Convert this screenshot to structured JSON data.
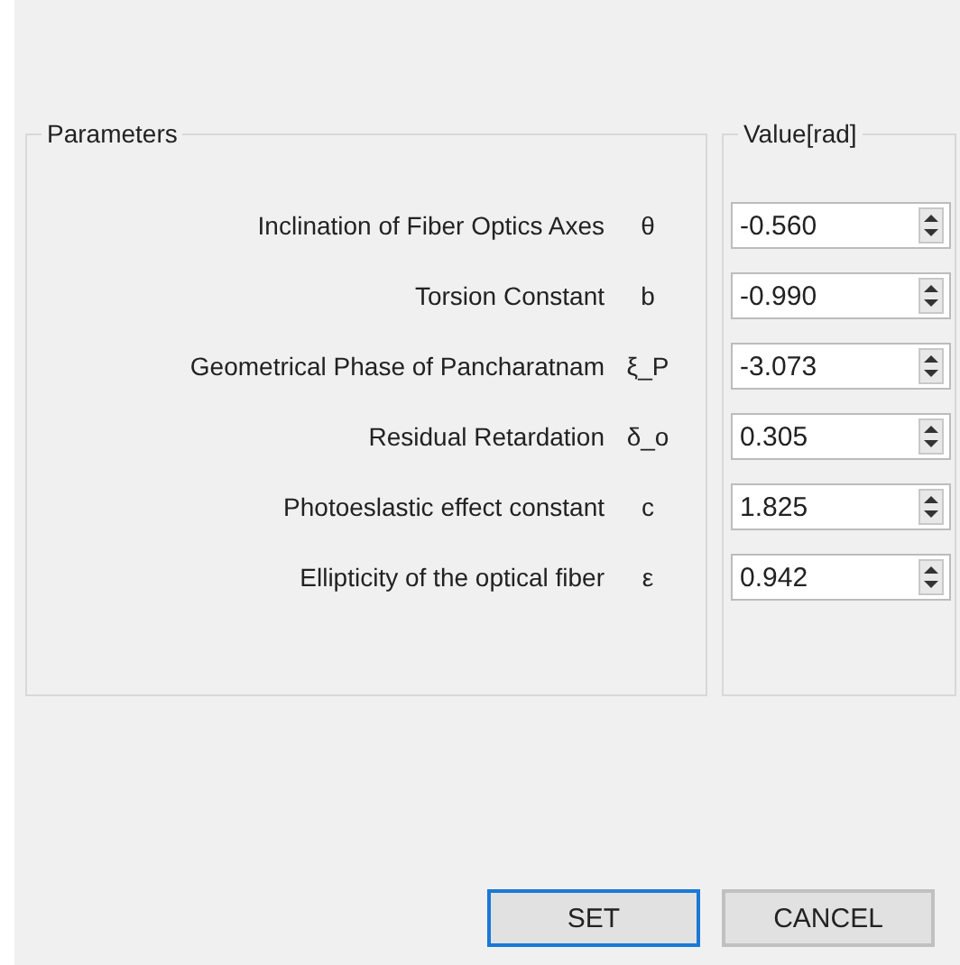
{
  "parameters_group": {
    "title": "Parameters"
  },
  "value_group": {
    "title": "Value[rad]"
  },
  "parameters": [
    {
      "label": "Inclination of Fiber Optics Axes",
      "symbol": "θ",
      "value": "-0.560"
    },
    {
      "label": "Torsion Constant",
      "symbol": "b",
      "value": "-0.990"
    },
    {
      "label": "Geometrical Phase of Pancharatnam",
      "symbol": "ξ_P",
      "value": "-3.073"
    },
    {
      "label": "Residual Retardation",
      "symbol": "δ_o",
      "value": "0.305"
    },
    {
      "label": "Photoeslastic effect constant",
      "symbol": "c",
      "value": "1.825"
    },
    {
      "label": "Ellipticity of the optical fiber",
      "symbol": "ε",
      "value": "0.942"
    }
  ],
  "buttons": [
    {
      "label": "SET",
      "focused": true
    },
    {
      "label": "CANCEL",
      "focused": false
    }
  ]
}
